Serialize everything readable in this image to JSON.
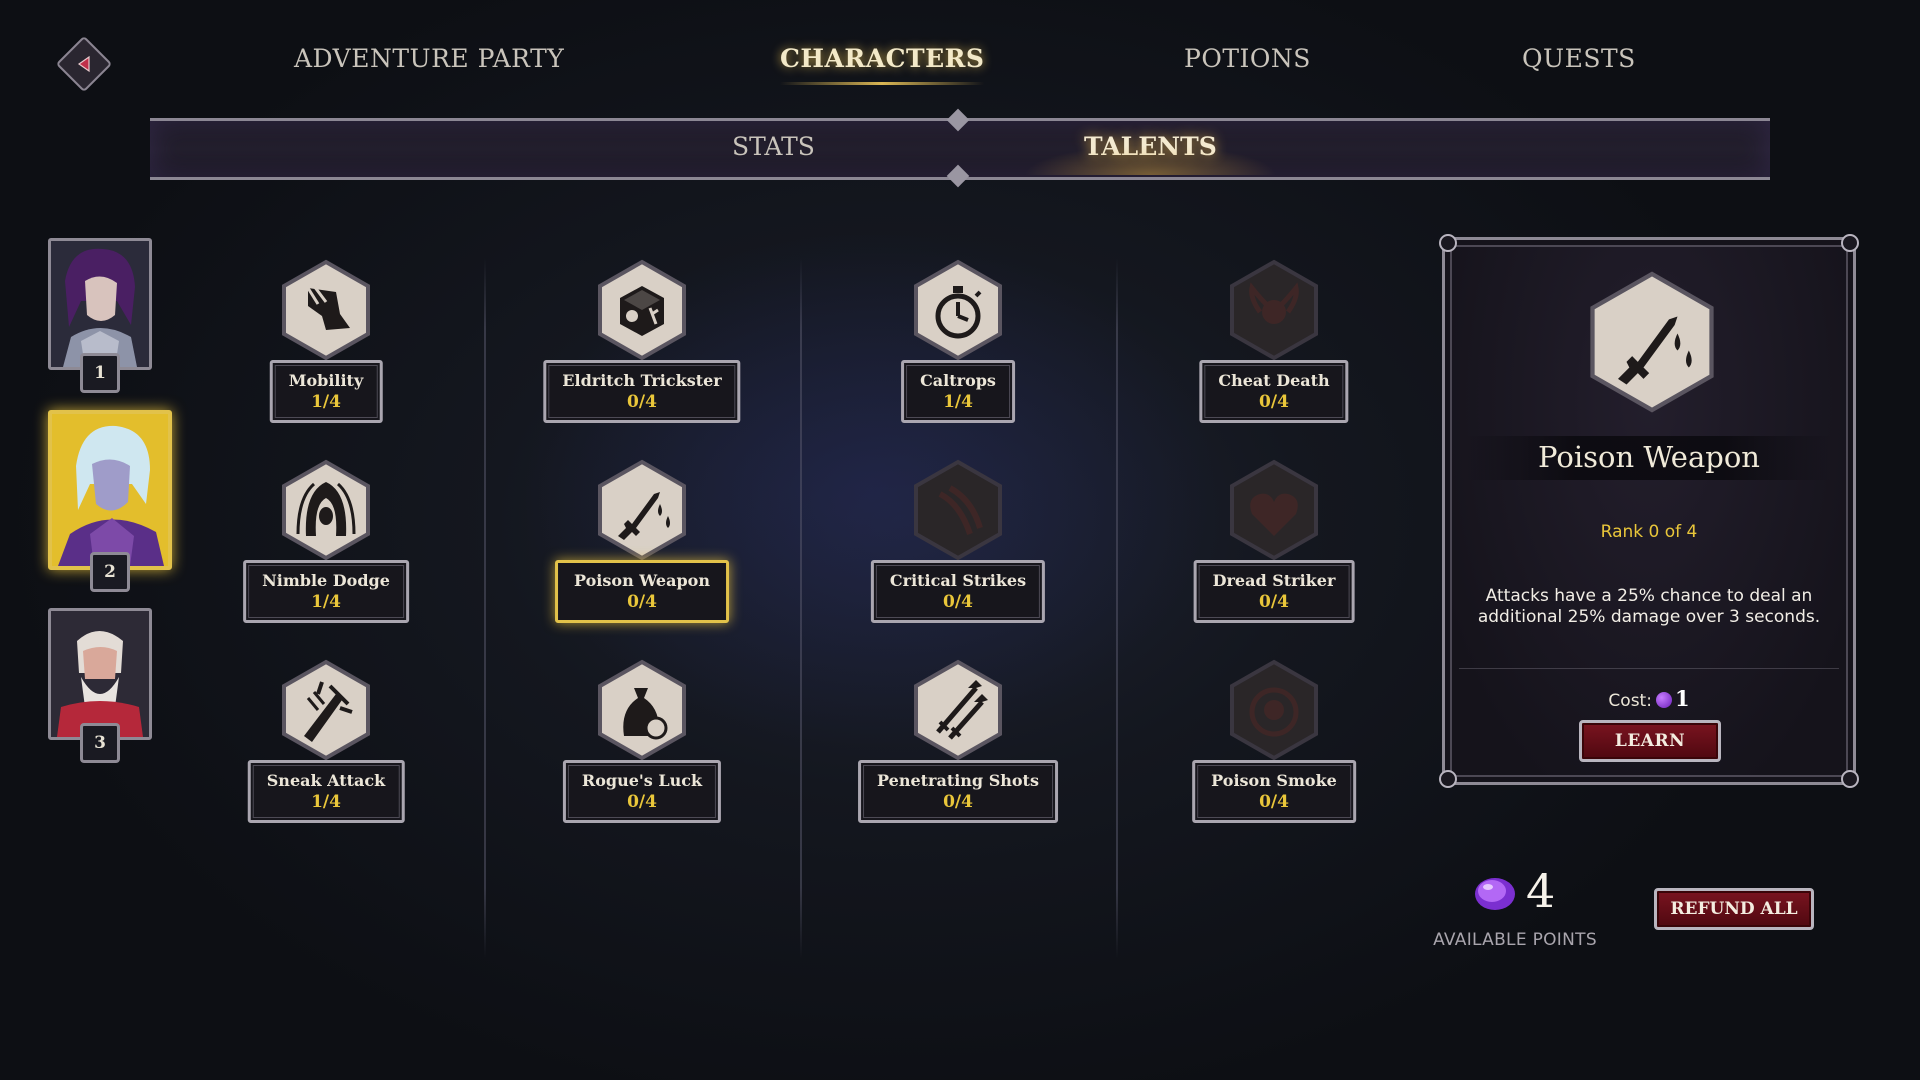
{
  "nav": {
    "tabs": [
      {
        "label": "ADVENTURE PARTY"
      },
      {
        "label": "CHARACTERS"
      },
      {
        "label": "POTIONS"
      },
      {
        "label": "QUESTS"
      }
    ],
    "active_tab": "CHARACTERS"
  },
  "subnav": {
    "tabs": [
      {
        "label": "STATS"
      },
      {
        "label": "TALENTS"
      }
    ],
    "active_tab": "TALENTS"
  },
  "party": [
    {
      "number": "1"
    },
    {
      "number": "2"
    },
    {
      "number": "3"
    }
  ],
  "selected_character": "2",
  "talents": {
    "col1": [
      {
        "name": "Mobility",
        "rank": "1/4",
        "icon": "boot-wing-icon"
      },
      {
        "name": "Nimble Dodge",
        "rank": "1/4",
        "icon": "hooded-rogue-icon"
      },
      {
        "name": "Sneak Attack",
        "rank": "1/4",
        "icon": "dagger-strike-icon"
      }
    ],
    "col2": [
      {
        "name": "Eldritch Trickster",
        "rank": "0/4",
        "icon": "rune-cube-icon"
      },
      {
        "name": "Poison Weapon",
        "rank": "0/4",
        "icon": "poison-dagger-icon"
      },
      {
        "name": "Rogue's Luck",
        "rank": "0/4",
        "icon": "coin-pouch-icon"
      }
    ],
    "col3": [
      {
        "name": "Caltrops",
        "rank": "1/4",
        "icon": "stopwatch-icon"
      },
      {
        "name": "Critical Strikes",
        "rank": "0/4",
        "icon": "claw-slash-icon"
      },
      {
        "name": "Penetrating Shots",
        "rank": "0/4",
        "icon": "arrows-icon"
      }
    ],
    "col4": [
      {
        "name": "Cheat Death",
        "rank": "0/4",
        "icon": "winged-skull-icon"
      },
      {
        "name": "Dread Striker",
        "rank": "0/4",
        "icon": "broken-heart-icon"
      },
      {
        "name": "Poison Smoke",
        "rank": "0/4",
        "icon": "skull-cloud-icon"
      }
    ]
  },
  "selected_talent": "Poison Weapon",
  "detail": {
    "title": "Poison Weapon",
    "rank_text": "Rank 0 of 4",
    "description": "Attacks have a 25% chance to deal an additional 25% damage over 3 seconds.",
    "cost_label": "Cost:",
    "cost_value": "1",
    "learn_label": "LEARN",
    "icon": "poison-dagger-icon"
  },
  "points": {
    "value": "4",
    "label": "AVAILABLE POINTS"
  },
  "refund_label": "REFUND ALL",
  "colors": {
    "accent_gold": "#e9c63a",
    "button_red": "#7a1420",
    "gem_purple": "#a44ce8"
  }
}
